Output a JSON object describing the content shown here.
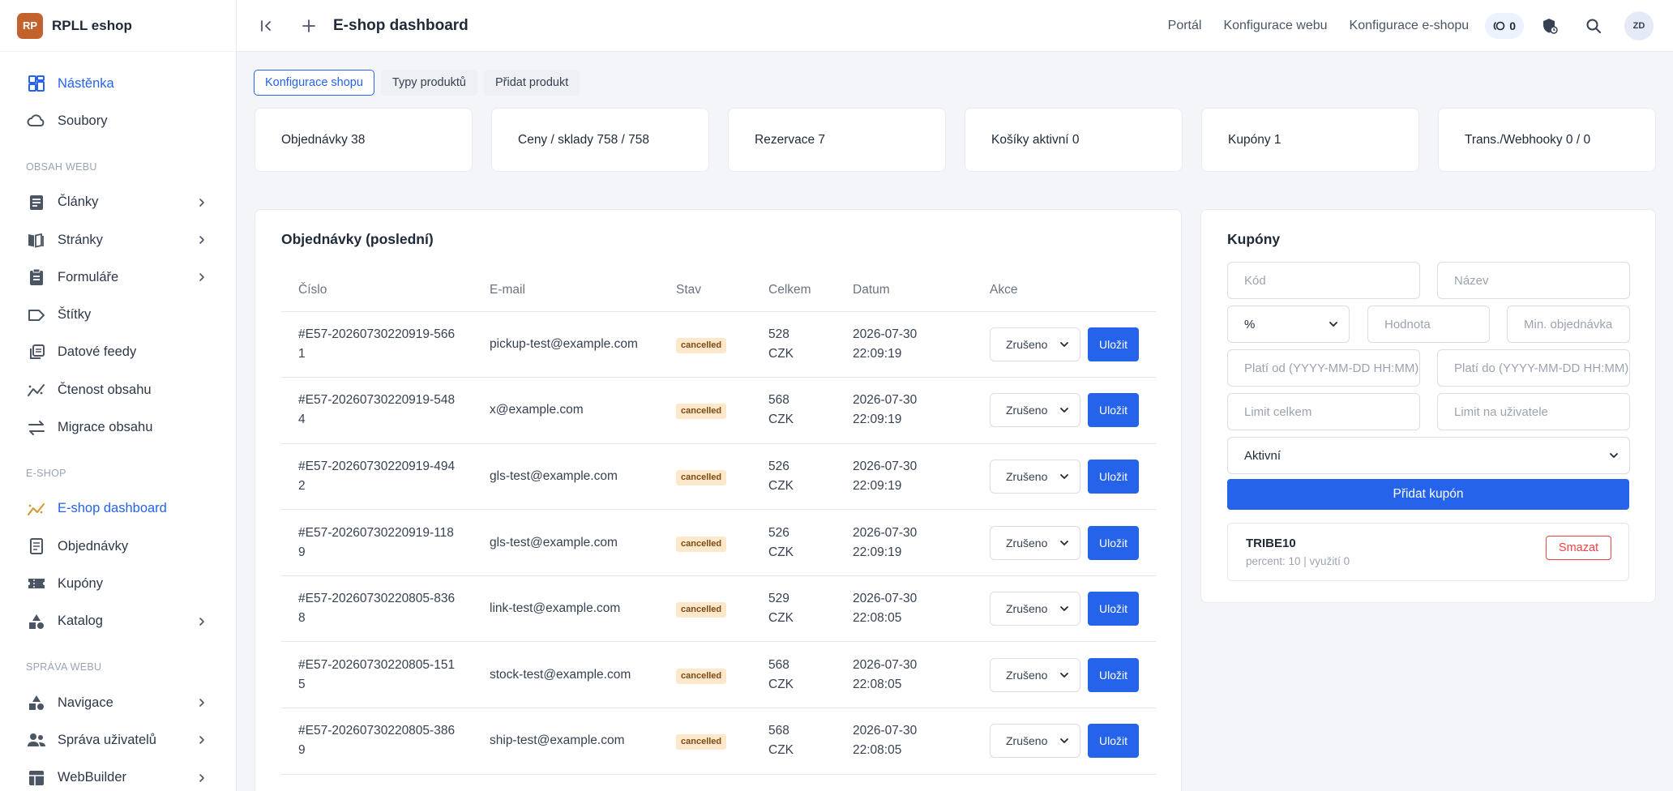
{
  "brand": {
    "logo": "RP",
    "name": "RPLL eshop"
  },
  "sidebar": {
    "items": [
      {
        "type": "item",
        "label": "Nástěnka",
        "icon": "dashboard-icon",
        "active": true,
        "chevron": false
      },
      {
        "type": "item",
        "label": "Soubory",
        "icon": "cloud-icon",
        "chevron": false
      },
      {
        "type": "section",
        "label": "OBSAH WEBU"
      },
      {
        "type": "item",
        "label": "Články",
        "icon": "article-icon",
        "chevron": true
      },
      {
        "type": "item",
        "label": "Stránky",
        "icon": "book-icon",
        "chevron": true
      },
      {
        "type": "item",
        "label": "Formuláře",
        "icon": "clipboard-icon",
        "chevron": true
      },
      {
        "type": "item",
        "label": "Štítky",
        "icon": "tag-icon",
        "chevron": false
      },
      {
        "type": "item",
        "label": "Datové feedy",
        "icon": "feed-icon",
        "chevron": false
      },
      {
        "type": "item",
        "label": "Čtenost obsahu",
        "icon": "analytics-icon",
        "chevron": false
      },
      {
        "type": "item",
        "label": "Migrace obsahu",
        "icon": "swap-icon",
        "chevron": false
      },
      {
        "type": "section",
        "label": "E-SHOP"
      },
      {
        "type": "item",
        "label": "E-shop dashboard",
        "icon": "chart-line-icon",
        "active": true,
        "chevron": false
      },
      {
        "type": "item",
        "label": "Objednávky",
        "icon": "receipt-icon",
        "chevron": false
      },
      {
        "type": "item",
        "label": "Kupóny",
        "icon": "coupon-icon",
        "chevron": false
      },
      {
        "type": "item",
        "label": "Katalog",
        "icon": "shapes-icon",
        "chevron": true
      },
      {
        "type": "section",
        "label": "SPRÁVA WEBU"
      },
      {
        "type": "item",
        "label": "Navigace",
        "icon": "navigation-icon",
        "chevron": true
      },
      {
        "type": "item",
        "label": "Správa uživatelů",
        "icon": "users-icon",
        "chevron": true
      },
      {
        "type": "item",
        "label": "WebBuilder",
        "icon": "builder-icon",
        "chevron": true
      }
    ]
  },
  "topbar": {
    "title": "E-shop dashboard",
    "links": [
      "Portál",
      "Konfigurace webu",
      "Konfigurace e-shopu"
    ],
    "counter": "0",
    "avatar": "ZD"
  },
  "subtabs": [
    {
      "label": "Konfigurace shopu",
      "active": true
    },
    {
      "label": "Typy produktů",
      "active": false
    },
    {
      "label": "Přidat produkt",
      "active": false
    }
  ],
  "stats": [
    "Objednávky 38",
    "Ceny / sklady 758 / 758",
    "Rezervace 7",
    "Košíky aktivní 0",
    "Kupóny 1",
    "Trans./Webhooky 0 / 0"
  ],
  "orders": {
    "title": "Objednávky (poslední)",
    "columns": [
      "Číslo",
      "E-mail",
      "Stav",
      "Celkem",
      "Datum",
      "Akce"
    ],
    "rows": [
      {
        "number": "#E57-20260730220919-5661",
        "email": "pickup-test@example.com",
        "status": "cancelled",
        "total": "528 CZK",
        "date": "2026-07-30 22:09:19",
        "action": "Zrušeno",
        "save": "Uložit"
      },
      {
        "number": "#E57-20260730220919-5484",
        "email": "x@example.com",
        "status": "cancelled",
        "total": "568 CZK",
        "date": "2026-07-30 22:09:19",
        "action": "Zrušeno",
        "save": "Uložit"
      },
      {
        "number": "#E57-20260730220919-4942",
        "email": "gls-test@example.com",
        "status": "cancelled",
        "total": "526 CZK",
        "date": "2026-07-30 22:09:19",
        "action": "Zrušeno",
        "save": "Uložit"
      },
      {
        "number": "#E57-20260730220919-1189",
        "email": "gls-test@example.com",
        "status": "cancelled",
        "total": "526 CZK",
        "date": "2026-07-30 22:09:19",
        "action": "Zrušeno",
        "save": "Uložit"
      },
      {
        "number": "#E57-20260730220805-8368",
        "email": "link-test@example.com",
        "status": "cancelled",
        "total": "529 CZK",
        "date": "2026-07-30 22:08:05",
        "action": "Zrušeno",
        "save": "Uložit"
      },
      {
        "number": "#E57-20260730220805-1515",
        "email": "stock-test@example.com",
        "status": "cancelled",
        "total": "568 CZK",
        "date": "2026-07-30 22:08:05",
        "action": "Zrušeno",
        "save": "Uložit"
      },
      {
        "number": "#E57-20260730220805-3869",
        "email": "ship-test@example.com",
        "status": "cancelled",
        "total": "568 CZK",
        "date": "2026-07-30 22:08:05",
        "action": "Zrušeno",
        "save": "Uložit"
      }
    ]
  },
  "coupons": {
    "title": "Kupóny",
    "placeholders": {
      "code": "Kód",
      "name": "Název",
      "value": "Hodnota",
      "min_order": "Min. objednávka",
      "valid_from": "Platí od (YYYY-MM-DD HH:MM)",
      "valid_to": "Platí do (YYYY-MM-DD HH:MM)",
      "limit_total": "Limit celkem",
      "limit_user": "Limit na uživatele"
    },
    "type_selected": "%",
    "status_selected": "Aktivní",
    "add_button": "Přidat kupón",
    "items": [
      {
        "code": "TRIBE10",
        "meta": "percent: 10 | využití 0",
        "delete": "Smazat"
      }
    ]
  },
  "colors": {
    "accent": "#2563eb",
    "brand": "#c2622d",
    "danger": "#ef4444",
    "badge_bg": "#fde8cc"
  }
}
